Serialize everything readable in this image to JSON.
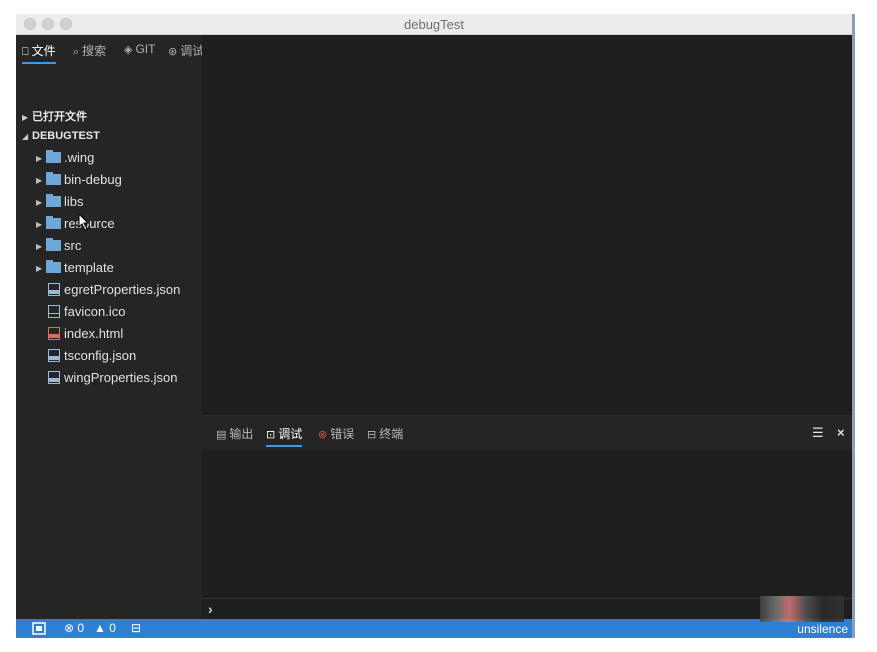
{
  "window": {
    "title": "debugTest"
  },
  "sidebar": {
    "tabs": [
      {
        "icon": "file-icon",
        "glyph": "⎕",
        "label": "文件"
      },
      {
        "icon": "search-icon",
        "glyph": "⌕",
        "label": "搜索"
      },
      {
        "icon": "git-icon",
        "glyph": "◈",
        "label": "GIT"
      },
      {
        "icon": "debug-icon",
        "glyph": "⊛",
        "label": "调试"
      }
    ],
    "open_files_label": "已打开文件",
    "project_label": "DEBUGTEST",
    "folders": [
      ".wing",
      "bin-debug",
      "libs",
      "resource",
      "src",
      "template"
    ],
    "files": [
      {
        "name": "egretProperties.json",
        "type": "json",
        "tag": "json"
      },
      {
        "name": "favicon.ico",
        "type": "plain",
        "tag": ""
      },
      {
        "name": "index.html",
        "type": "html",
        "tag": "html"
      },
      {
        "name": "tsconfig.json",
        "type": "json",
        "tag": "json"
      },
      {
        "name": "wingProperties.json",
        "type": "json",
        "tag": "json"
      }
    ]
  },
  "panel": {
    "tabs": [
      {
        "icon": "output-icon",
        "glyph": "▤",
        "label": "输出"
      },
      {
        "icon": "debug-console-icon",
        "glyph": "⊡",
        "label": "调试"
      },
      {
        "icon": "error-icon",
        "glyph": "⊗",
        "label": "错误"
      },
      {
        "icon": "terminal-icon",
        "glyph": "⊟",
        "label": "终端"
      }
    ],
    "clear_glyph": "☰",
    "close_glyph": "×",
    "prompt": "›"
  },
  "statusbar": {
    "errors": "0",
    "warnings": "0",
    "user": "unsilence"
  },
  "colors": {
    "accent": "#3c9ae8",
    "statusbar": "#2f7fd3",
    "folder": "#6fa7d9"
  }
}
